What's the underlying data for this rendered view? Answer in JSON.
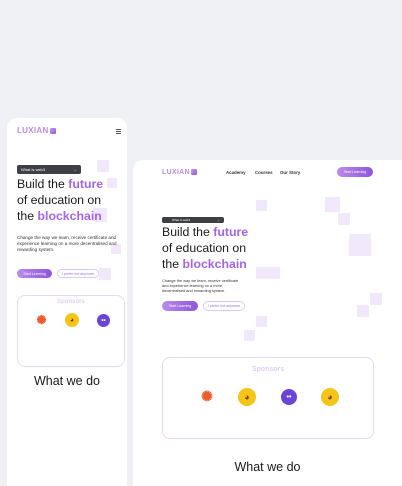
{
  "brand": {
    "logo": "LUXIAN"
  },
  "nav": {
    "links": [
      "Academy",
      "Courses",
      "Our Story"
    ],
    "cta": "Start Learning"
  },
  "hero": {
    "pill_text": "What is web3",
    "pill_arrow": "→",
    "headline_1": "Build the ",
    "headline_accent_1": "future",
    "headline_2": "of education on",
    "headline_3": "the ",
    "headline_accent_2": "blockchain",
    "description": "Change the way we learn, receive certificate and experience learning on a more decentralised and rewarding system.",
    "primary_button": "Start Learning",
    "secondary_button": "I prefer not anymore"
  },
  "sponsors": {
    "title": "Sponsors",
    "icons": [
      "spark-icon",
      "shiba-icon",
      "chat-icon",
      "shiba-icon"
    ]
  },
  "section": {
    "title": "What we do"
  },
  "colors": {
    "accent": "#a365e8",
    "accent_light": "#f1e9fb",
    "dark_pill": "#3f3f46"
  }
}
